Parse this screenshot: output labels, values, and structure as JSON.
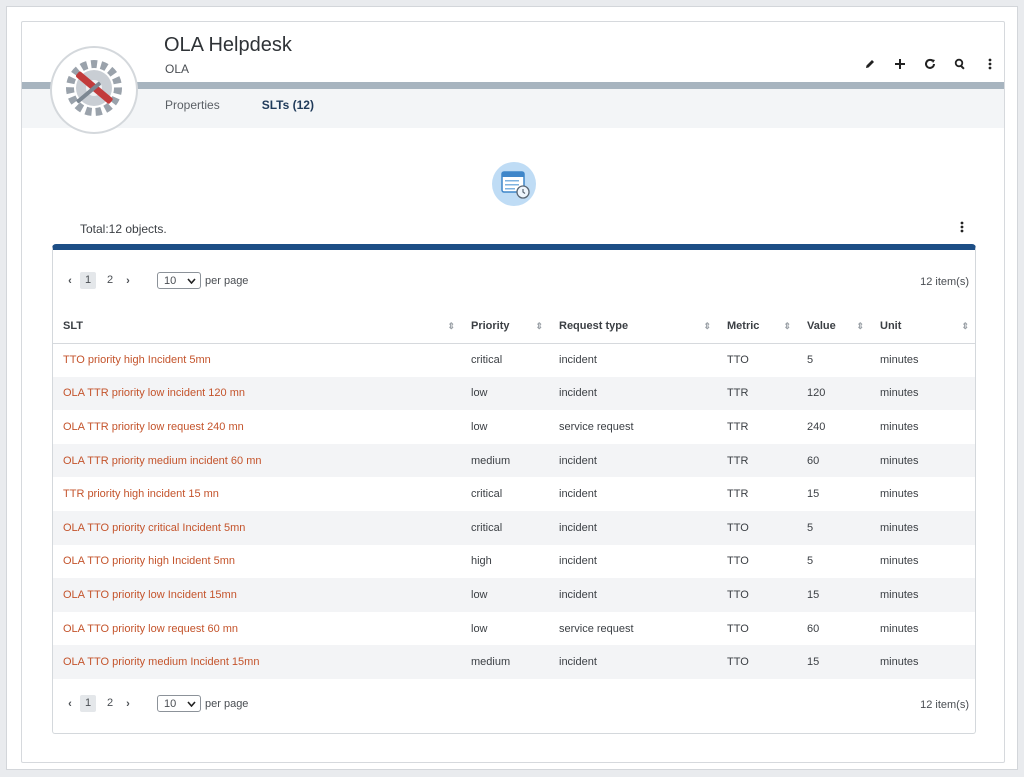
{
  "header": {
    "title": "OLA Helpdesk",
    "subtitle": "OLA",
    "actions": [
      "edit-icon",
      "add-icon",
      "refresh-icon",
      "search-icon",
      "more-icon"
    ]
  },
  "tabs": [
    {
      "label": "Properties",
      "active": false
    },
    {
      "label": "SLTs (12)",
      "active": true
    }
  ],
  "list": {
    "total_label": "Total:12 objects.",
    "pager": {
      "pages": [
        "1",
        "2"
      ],
      "current_page": "1",
      "per_page_value": "10",
      "per_page_label": "per page",
      "items_label": "12 item(s)"
    },
    "columns": [
      "SLT",
      "Priority",
      "Request type",
      "Metric",
      "Value",
      "Unit"
    ],
    "rows": [
      [
        "TTO priority high Incident 5mn",
        "critical",
        "incident",
        "TTO",
        "5",
        "minutes"
      ],
      [
        "OLA TTR priority low incident 120 mn",
        "low",
        "incident",
        "TTR",
        "120",
        "minutes"
      ],
      [
        "OLA TTR priority low request 240 mn",
        "low",
        "service request",
        "TTR",
        "240",
        "minutes"
      ],
      [
        "OLA TTR priority medium incident 60 mn",
        "medium",
        "incident",
        "TTR",
        "60",
        "minutes"
      ],
      [
        "TTR priority high incident 15 mn",
        "critical",
        "incident",
        "TTR",
        "15",
        "minutes"
      ],
      [
        "OLA TTO priority critical Incident 5mn",
        "critical",
        "incident",
        "TTO",
        "5",
        "minutes"
      ],
      [
        "OLA TTO priority high Incident 5mn",
        "high",
        "incident",
        "TTO",
        "5",
        "minutes"
      ],
      [
        "OLA TTO priority low Incident 15mn",
        "low",
        "incident",
        "TTO",
        "15",
        "minutes"
      ],
      [
        "OLA TTO priority low request 60 mn",
        "low",
        "service request",
        "TTO",
        "60",
        "minutes"
      ],
      [
        "OLA TTO priority medium Incident 15mn",
        "medium",
        "incident",
        "TTO",
        "15",
        "minutes"
      ]
    ]
  },
  "colors": {
    "link": "#c4542c",
    "table_accent": "#1d4e86",
    "header_band": "#a7b4bf"
  }
}
